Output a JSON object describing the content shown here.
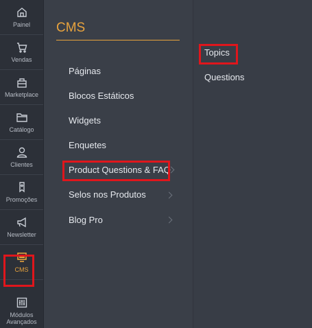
{
  "rail": {
    "items": [
      {
        "label": "Painel",
        "icon": "home-icon"
      },
      {
        "label": "Vendas",
        "icon": "cart-icon"
      },
      {
        "label": "Marketplace",
        "icon": "store-icon"
      },
      {
        "label": "Catálogo",
        "icon": "folder-icon"
      },
      {
        "label": "Clientes",
        "icon": "user-icon"
      },
      {
        "label": "Promoções",
        "icon": "tag-icon"
      },
      {
        "label": "Newsletter",
        "icon": "megaphone-icon"
      },
      {
        "label": "CMS",
        "icon": "monitor-icon"
      },
      {
        "label": "Módulos Avançados",
        "icon": "modules-icon"
      }
    ],
    "active": "CMS"
  },
  "panel": {
    "title": "CMS",
    "items": [
      "Páginas",
      "Blocos Estáticos",
      "Widgets",
      "Enquetes",
      "Product Questions & FAQ",
      "Selos nos Produtos",
      "Blog Pro"
    ]
  },
  "submenu": {
    "items": [
      "Topics",
      "Questions"
    ]
  },
  "colors": {
    "accent": "#e8a33d",
    "highlight": "#e0161c",
    "rail_bg": "#2c3038",
    "panel_bg": "#3a3f48"
  }
}
